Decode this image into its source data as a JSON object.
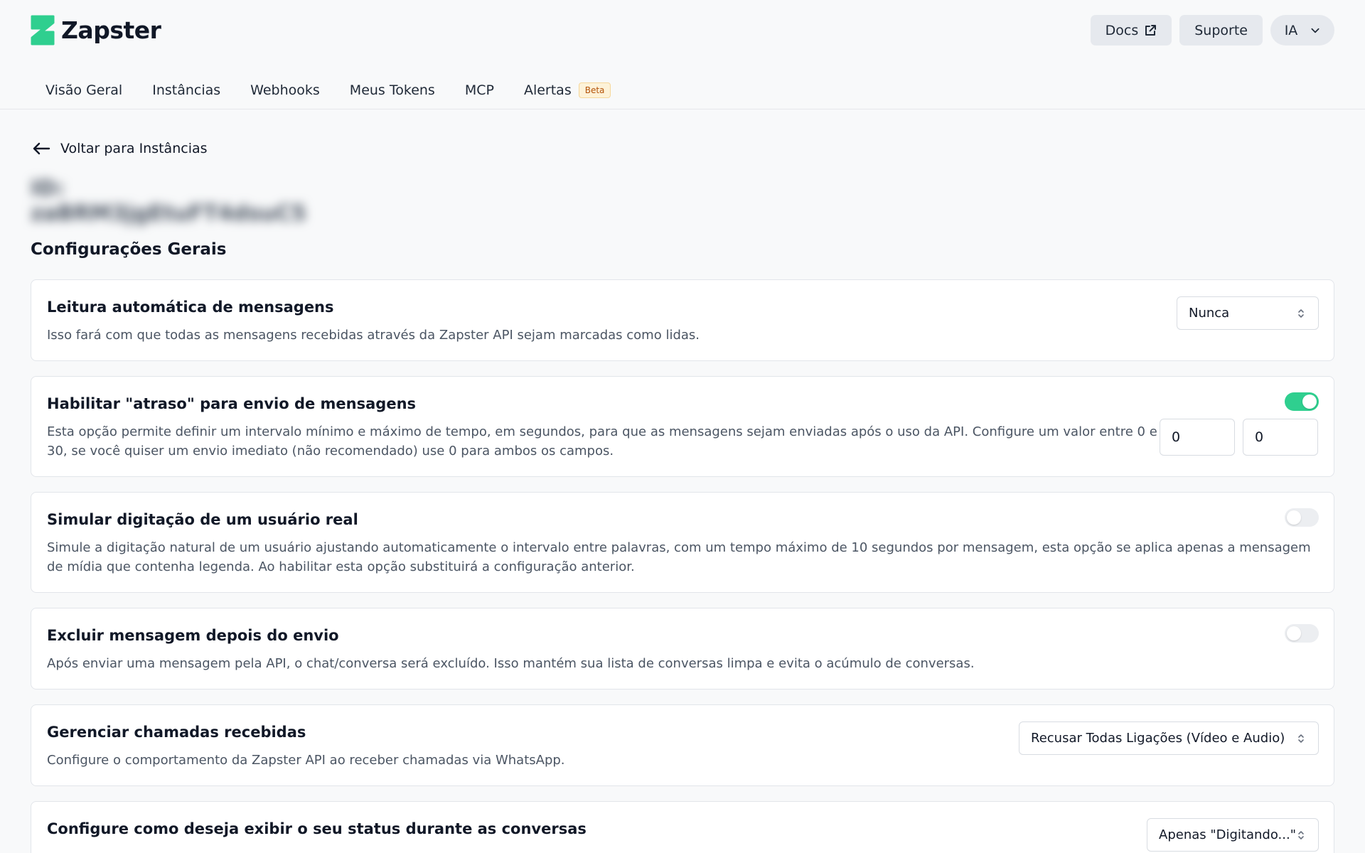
{
  "brand": {
    "name": "Zapster",
    "color": "#2fcf8f"
  },
  "header": {
    "docs_label": "Docs",
    "support_label": "Suporte",
    "user_initials": "IA"
  },
  "nav": {
    "items": [
      {
        "label": "Visão Geral"
      },
      {
        "label": "Instâncias"
      },
      {
        "label": "Webhooks"
      },
      {
        "label": "Meus Tokens"
      },
      {
        "label": "MCP"
      },
      {
        "label": "Alertas",
        "badge": "Beta"
      }
    ]
  },
  "back_label": "Voltar para Instâncias",
  "instance_title_blurred": "ID: zaBRM3jgEtuFT4dsuC5",
  "section_title": "Configurações Gerais",
  "settings": {
    "auto_read": {
      "title": "Leitura automática de mensagens",
      "description": "Isso fará com que todas as mensagens recebidas através da Zapster API sejam marcadas como lidas.",
      "selected": "Nunca"
    },
    "delay": {
      "title": "Habilitar \"atraso\" para envio de mensagens",
      "description_line1": "Esta opção permite definir um intervalo mínimo e máximo de tempo, em segundos, para que as mensagens sejam enviadas após o uso da API. Configure um valor entre 0 e",
      "description_line2": "30, se você quiser um envio imediato (não recomendado) use 0 para ambos os campos.",
      "enabled": true,
      "min_value": "0",
      "max_value": "0"
    },
    "typing": {
      "title": "Simular digitação de um usuário real",
      "description_line1": "Simule a digitação natural de um usuário ajustando automaticamente o intervalo entre palavras, com um tempo máximo de 10 segundos por mensagem, esta opção se aplica apenas a mensagem",
      "description_line2": "de mídia que contenha legenda. Ao habilitar esta opção substituirá a configuração anterior.",
      "enabled": false
    },
    "delete_after": {
      "title": "Excluir mensagem depois do envio",
      "description": "Após enviar uma mensagem pela API, o chat/conversa será excluído. Isso mantém sua lista de conversas limpa e evita o acúmulo de conversas.",
      "enabled": false
    },
    "calls": {
      "title": "Gerenciar chamadas recebidas",
      "description": "Configure o comportamento da Zapster API ao receber chamadas via WhatsApp.",
      "selected": "Recusar Todas Ligações (Vídeo e Audio)"
    },
    "status": {
      "title": "Configure como deseja exibir o seu status durante as conversas",
      "selected": "Apenas \"Digitando...\""
    }
  }
}
